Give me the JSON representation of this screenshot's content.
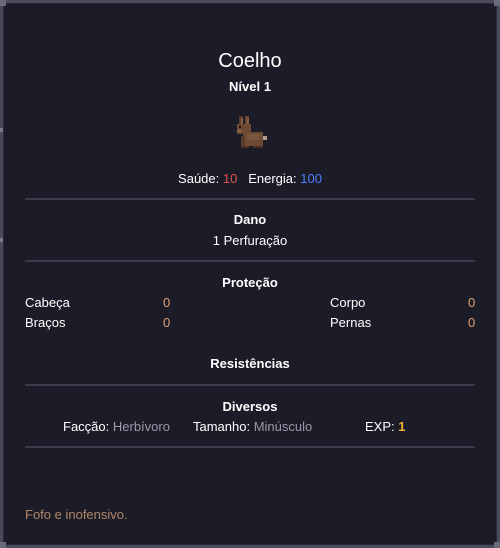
{
  "creature": {
    "name": "Coelho",
    "level": "Nível 1",
    "sprite_icon": "rabbit-icon"
  },
  "stats": {
    "health_label": "Saúde:",
    "health_value": "10",
    "energy_label": "Energia:",
    "energy_value": "100"
  },
  "damage": {
    "title": "Dano",
    "value": "1 Perfuração"
  },
  "protection": {
    "title": "Proteção",
    "items": [
      {
        "label": "Cabeça",
        "value": "0"
      },
      {
        "label": "Corpo",
        "value": "0"
      },
      {
        "label": "Braços",
        "value": "0"
      },
      {
        "label": "Pernas",
        "value": "0"
      }
    ]
  },
  "resistances": {
    "title": "Resistências"
  },
  "misc": {
    "title": "Diversos",
    "faction_label": "Facção:",
    "faction_value": "Herbívoro",
    "size_label": "Tamanho:",
    "size_value": "Minúsculo",
    "exp_label": "EXP:",
    "exp_value": "1"
  },
  "description": "Fofo e inofensivo.",
  "colors": {
    "health": "#e05050",
    "energy": "#4f7fff",
    "stat_value": "#e0a070",
    "exp": "#f0b030",
    "flavor": "#b08868"
  }
}
